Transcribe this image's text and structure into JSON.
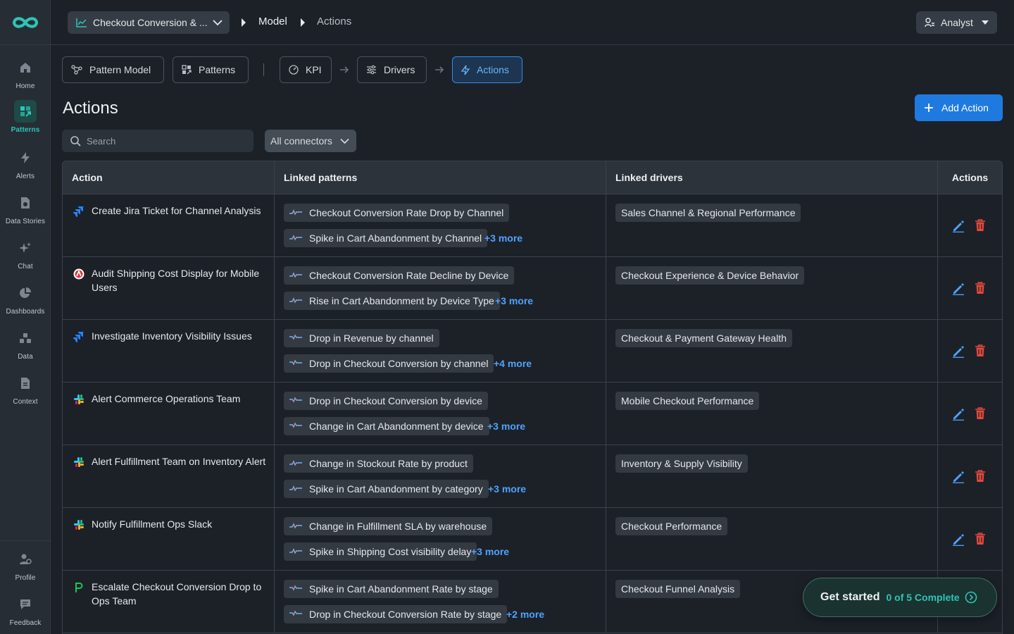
{
  "sidebar": {
    "items": [
      {
        "label": "Home"
      },
      {
        "label": "Patterns"
      },
      {
        "label": "Alerts"
      },
      {
        "label": "Data Stories"
      },
      {
        "label": "Chat"
      },
      {
        "label": "Dashboards"
      },
      {
        "label": "Data"
      },
      {
        "label": "Context"
      }
    ],
    "bottom": [
      {
        "label": "Profile"
      },
      {
        "label": "Feedback"
      }
    ]
  },
  "topbar": {
    "dataset": "Checkout Conversion & ...",
    "breadcrumb": [
      "Model",
      "Actions"
    ],
    "role": "Analyst"
  },
  "steps": {
    "pattern_model": "Pattern Model",
    "patterns": "Patterns",
    "kpi": "KPI",
    "drivers": "Drivers",
    "actions": "Actions"
  },
  "page": {
    "title": "Actions",
    "add_button": "Add Action",
    "search_placeholder": "Search",
    "connector_filter": "All connectors"
  },
  "table": {
    "headers": [
      "Action",
      "Linked patterns",
      "Linked drivers",
      "Actions"
    ],
    "rows": [
      {
        "icon": "jira-icon",
        "action": "Create Jira Ticket for Channel Analysis",
        "patterns": [
          "Checkout Conversion Rate Drop by Channel",
          "Spike in Cart Abandonment by Channel"
        ],
        "more": "+3 more",
        "driver": "Sales Channel & Regional Performance"
      },
      {
        "icon": "ops-icon",
        "action": "Audit Shipping Cost Display for Mobile Users",
        "patterns": [
          "Checkout Conversion Rate Decline by Device",
          "Rise in Cart Abandonment by Device Type"
        ],
        "more": "+3 more",
        "driver": "Checkout Experience & Device Behavior"
      },
      {
        "icon": "jira-icon",
        "action": "Investigate Inventory Visibility Issues",
        "patterns": [
          "Drop in Revenue by channel",
          "Drop in Checkout Conversion by channel"
        ],
        "more": "+4 more",
        "driver": "Checkout & Payment Gateway Health"
      },
      {
        "icon": "slack-icon",
        "action": "Alert Commerce Operations Team",
        "patterns": [
          "Drop in Checkout Conversion by device",
          "Change in Cart Abandonment by device"
        ],
        "more": "+3 more",
        "driver": "Mobile Checkout Performance"
      },
      {
        "icon": "slack-icon",
        "action": "Alert Fulfillment Team on Inventory Alert",
        "patterns": [
          "Change in Stockout Rate by product",
          "Spike in Cart Abandonment by category"
        ],
        "more": "+3 more",
        "driver": "Inventory & Supply Visibility"
      },
      {
        "icon": "slack-icon",
        "action": "Notify Fulfillment Ops Slack",
        "patterns": [
          "Change in Fulfillment SLA by warehouse",
          "Spike in Shipping Cost visibility delay"
        ],
        "more": "+3 more",
        "driver": "Checkout Performance"
      },
      {
        "icon": "pagerduty-icon",
        "action": "Escalate Checkout Conversion Drop to Ops Team",
        "patterns": [
          "Spike in Cart Abandonment Rate by stage",
          "Drop in Checkout Conversion Rate by stage"
        ],
        "more": "+2 more",
        "driver": "Checkout Funnel Analysis"
      }
    ]
  },
  "get_started": {
    "title": "Get started",
    "progress": "0 of 5 Complete"
  },
  "colors": {
    "accent_teal": "#2ec4b6",
    "primary_blue": "#1f7ae0",
    "link_blue": "#4ea3ff",
    "delete_red": "#e5483b"
  }
}
